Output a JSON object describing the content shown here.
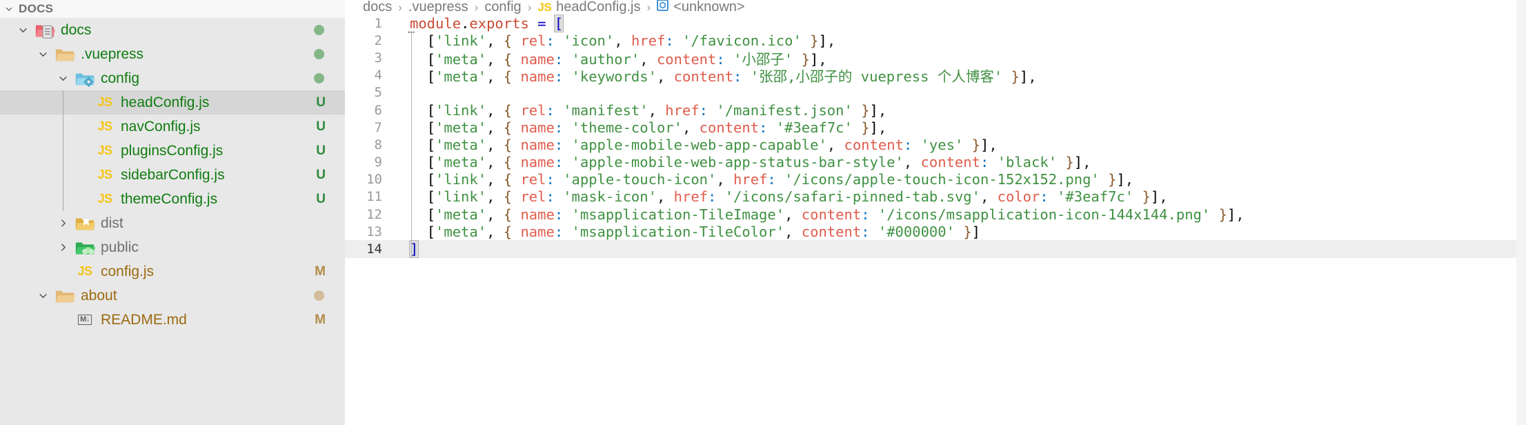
{
  "sidebar": {
    "header": {
      "title": "DOCS",
      "expanded": true
    },
    "tree": [
      {
        "label": "docs",
        "type": "folder",
        "icon": "folder-docs-icon",
        "depth": 0,
        "state": "expanded",
        "badge": "",
        "badge_kind": "dot-green",
        "name_color": "#107c10",
        "selected": false
      },
      {
        "label": ".vuepress",
        "type": "folder",
        "icon": "folder-plain-icon",
        "depth": 1,
        "state": "expanded",
        "badge": "",
        "badge_kind": "dot-green",
        "name_color": "#107c10",
        "selected": false
      },
      {
        "label": "config",
        "type": "folder",
        "icon": "folder-config-icon",
        "depth": 2,
        "state": "expanded",
        "badge": "",
        "badge_kind": "dot-green",
        "name_color": "#107c10",
        "selected": false
      },
      {
        "label": "headConfig.js",
        "type": "file",
        "icon": "js-file-icon",
        "depth": 3,
        "state": "leaf",
        "badge": "U",
        "badge_kind": "letter-green",
        "name_color": "#107c10",
        "selected": true
      },
      {
        "label": "navConfig.js",
        "type": "file",
        "icon": "js-file-icon",
        "depth": 3,
        "state": "leaf",
        "badge": "U",
        "badge_kind": "letter-green",
        "name_color": "#107c10",
        "selected": false
      },
      {
        "label": "pluginsConfig.js",
        "type": "file",
        "icon": "js-file-icon",
        "depth": 3,
        "state": "leaf",
        "badge": "U",
        "badge_kind": "letter-green",
        "name_color": "#107c10",
        "selected": false
      },
      {
        "label": "sidebarConfig.js",
        "type": "file",
        "icon": "js-file-icon",
        "depth": 3,
        "state": "leaf",
        "badge": "U",
        "badge_kind": "letter-green",
        "name_color": "#107c10",
        "selected": false
      },
      {
        "label": "themeConfig.js",
        "type": "file",
        "icon": "js-file-icon",
        "depth": 3,
        "state": "leaf",
        "badge": "U",
        "badge_kind": "letter-green",
        "name_color": "#107c10",
        "selected": false
      },
      {
        "label": "dist",
        "type": "folder",
        "icon": "folder-dist-icon",
        "depth": 2,
        "state": "collapsed",
        "badge": "",
        "badge_kind": "none",
        "name_color": "#6f6f6f",
        "selected": false
      },
      {
        "label": "public",
        "type": "folder",
        "icon": "folder-public-icon",
        "depth": 2,
        "state": "collapsed",
        "badge": "",
        "badge_kind": "none",
        "name_color": "#6f6f6f",
        "selected": false
      },
      {
        "label": "config.js",
        "type": "file",
        "icon": "js-file-icon",
        "depth": 2,
        "state": "leaf",
        "badge": "M",
        "badge_kind": "letter-ochre",
        "name_color": "#9b6a10",
        "selected": false
      },
      {
        "label": "about",
        "type": "folder",
        "icon": "folder-plain-icon",
        "depth": 1,
        "state": "expanded",
        "badge": "",
        "badge_kind": "dot-ochre",
        "name_color": "#9b6a10",
        "selected": false
      },
      {
        "label": "README.md",
        "type": "file",
        "icon": "markdown-file-icon",
        "depth": 2,
        "state": "leaf",
        "badge": "M",
        "badge_kind": "letter-ochre",
        "name_color": "#9b6a10",
        "selected": false
      }
    ]
  },
  "editor": {
    "breadcrumb": [
      {
        "label": "docs",
        "icon": ""
      },
      {
        "label": ".vuepress",
        "icon": ""
      },
      {
        "label": "config",
        "icon": ""
      },
      {
        "label": "headConfig.js",
        "icon": "js-file-icon"
      },
      {
        "label": "<unknown>",
        "icon": "symbol-object-icon"
      }
    ],
    "breadcrumb_separator": "›",
    "current_line": 14,
    "lines": [
      {
        "n": "1",
        "text": "module.exports = ["
      },
      {
        "n": "2",
        "text": "  ['link', { rel: 'icon', href: '/favicon.ico' }],"
      },
      {
        "n": "3",
        "text": "  ['meta', { name: 'author', content: '小邵子' }],"
      },
      {
        "n": "4",
        "text": "  ['meta', { name: 'keywords', content: '张邵,小邵子的 vuepress 个人博客' }],"
      },
      {
        "n": "5",
        "text": ""
      },
      {
        "n": "6",
        "text": "  ['link', { rel: 'manifest', href: '/manifest.json' }],"
      },
      {
        "n": "7",
        "text": "  ['meta', { name: 'theme-color', content: '#3eaf7c' }],"
      },
      {
        "n": "8",
        "text": "  ['meta', { name: 'apple-mobile-web-app-capable', content: 'yes' }],"
      },
      {
        "n": "9",
        "text": "  ['meta', { name: 'apple-mobile-web-app-status-bar-style', content: 'black' }],"
      },
      {
        "n": "10",
        "text": "  ['link', { rel: 'apple-touch-icon', href: '/icons/apple-touch-icon-152x152.png' }],"
      },
      {
        "n": "11",
        "text": "  ['link', { rel: 'mask-icon', href: '/icons/safari-pinned-tab.svg', color: '#3eaf7c' }],"
      },
      {
        "n": "12",
        "text": "  ['meta', { name: 'msapplication-TileImage', content: '/icons/msapplication-icon-144x144.png' }],"
      },
      {
        "n": "13",
        "text": "  ['meta', { name: 'msapplication-TileColor', content: '#000000' }]"
      },
      {
        "n": "14",
        "text": "]"
      }
    ]
  },
  "colors": {
    "sidebar_bg": "#e8e8e8",
    "sidebar_header_bg": "#f8f8f8",
    "selected_row_bg": "#d6d6d6",
    "editor_bg": "#ffffff",
    "current_line_bg": "#eeeeee",
    "untracked_green": "#2f8a3e",
    "modified_ochre": "#b58b4a",
    "string_green": "#3f9142",
    "keyword_red": "#c94b32",
    "js_yellow": "#f5c518"
  }
}
